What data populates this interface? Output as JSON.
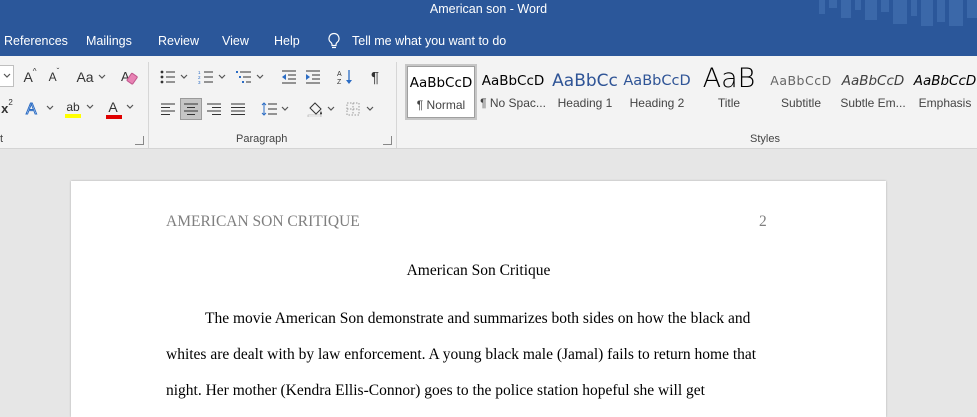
{
  "window": {
    "title": "American son  -  Word"
  },
  "tabs": [
    "References",
    "Mailings",
    "Review",
    "View",
    "Help"
  ],
  "tell_me": {
    "text": "Tell me what you want to do"
  },
  "ribbon": {
    "paragraph_label": "Paragraph",
    "styles_label": "Styles",
    "font_label_fragment": "t",
    "buttons": {
      "grow_font": "A",
      "shrink_font": "A",
      "change_case": "Aa",
      "superscript": "x",
      "highlight": "ab",
      "font_color": "A",
      "pilcrow": "¶"
    },
    "styles": [
      {
        "sample": "AaBbCcD",
        "name": "¶ Normal"
      },
      {
        "sample": "AaBbCcD",
        "name": "¶ No Spac..."
      },
      {
        "sample": "AaBbCc",
        "name": "Heading 1"
      },
      {
        "sample": "AaBbCcD",
        "name": "Heading 2"
      },
      {
        "sample": "AaB",
        "name": "Title"
      },
      {
        "sample": "AaBbCcD",
        "name": "Subtitle"
      },
      {
        "sample": "AaBbCcD",
        "name": "Subtle Em..."
      },
      {
        "sample": "AaBbCcD",
        "name": "Emphasis"
      }
    ]
  },
  "document": {
    "header_title": "AMERICAN SON CRITIQUE",
    "page_number": "2",
    "title": "American Son Critique",
    "lines": [
      "The movie American Son demonstrate and summarizes both sides on how the black and",
      "whites are dealt with by law enforcement. A young black male (Jamal) fails to return home that",
      "night. Her mother (Kendra Ellis-Connor) goes to the police station hopeful she will get"
    ]
  },
  "colors": {
    "title_bar": "#2b579a",
    "ribbon_bg": "#f3f3f3",
    "canvas_bg": "#e6e6e6",
    "highlight_yellow": "#ffff00",
    "font_red": "#e00000"
  }
}
